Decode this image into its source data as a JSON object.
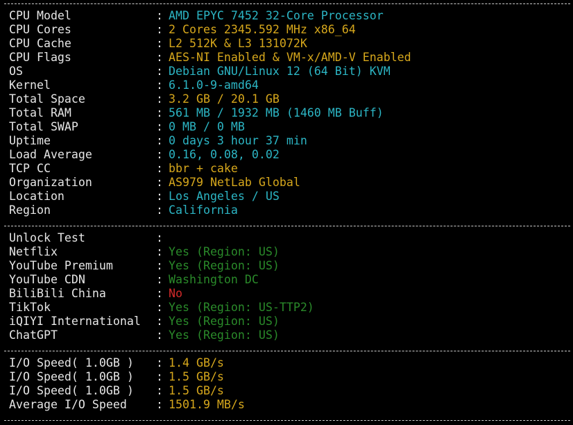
{
  "colors": {
    "cyan": "#2cb5c4",
    "yellow": "#d6a71c",
    "green": "#2a8a2a",
    "red": "#d22a2a"
  },
  "separator": "--------------------------------------------------------------------------------",
  "system": [
    {
      "label": "CPU Model",
      "value": "AMD EPYC 7452 32-Core Processor",
      "color": "cyan"
    },
    {
      "label": "CPU Cores",
      "value": "2 Cores 2345.592 MHz x86_64",
      "color": "yellow"
    },
    {
      "label": "CPU Cache",
      "value": "L2 512K & L3 131072K",
      "color": "yellow"
    },
    {
      "label": "CPU Flags",
      "value": "AES-NI Enabled & VM-x/AMD-V Enabled",
      "color": "yellow"
    },
    {
      "label": "OS",
      "value": "Debian GNU/Linux 12 (64 Bit) KVM",
      "color": "cyan"
    },
    {
      "label": "Kernel",
      "value": "6.1.0-9-amd64",
      "color": "cyan"
    },
    {
      "label": "Total Space",
      "value": "3.2 GB / 20.1 GB",
      "color": "yellow"
    },
    {
      "label": "Total RAM",
      "value": "561 MB / 1932 MB (1460 MB Buff)",
      "color": "cyan"
    },
    {
      "label": "Total SWAP",
      "value": "0 MB / 0 MB",
      "color": "cyan"
    },
    {
      "label": "Uptime",
      "value": "0 days 3 hour 37 min",
      "color": "cyan"
    },
    {
      "label": "Load Average",
      "value": "0.16, 0.08, 0.02",
      "color": "cyan"
    },
    {
      "label": "TCP CC",
      "value": "bbr + cake",
      "color": "yellow"
    },
    {
      "label": "Organization",
      "value": "AS979 NetLab Global",
      "color": "yellow"
    },
    {
      "label": "Location",
      "value": "Los Angeles / US",
      "color": "cyan"
    },
    {
      "label": "Region",
      "value": "California",
      "color": "cyan"
    }
  ],
  "unlock": [
    {
      "label": "Unlock Test",
      "value": "",
      "color": "cyan"
    },
    {
      "label": "Netflix",
      "value": "Yes (Region: US)",
      "color": "green"
    },
    {
      "label": "YouTube Premium",
      "value": "Yes (Region: US)",
      "color": "green"
    },
    {
      "label": "YouTube CDN",
      "value": "Washington DC",
      "color": "green"
    },
    {
      "label": "BiliBili China",
      "value": "No",
      "color": "red"
    },
    {
      "label": "TikTok",
      "value": "Yes (Region: US-TTP2)",
      "color": "green"
    },
    {
      "label": "iQIYI International",
      "value": "Yes (Region: US)",
      "color": "green"
    },
    {
      "label": "ChatGPT",
      "value": "Yes (Region: US)",
      "color": "green"
    }
  ],
  "io": [
    {
      "label": "I/O Speed( 1.0GB )",
      "value": "1.4 GB/s",
      "color": "yellow"
    },
    {
      "label": "I/O Speed( 1.0GB )",
      "value": "1.5 GB/s",
      "color": "yellow"
    },
    {
      "label": "I/O Speed( 1.0GB )",
      "value": "1.5 GB/s",
      "color": "yellow"
    },
    {
      "label": "Average I/O Speed",
      "value": "1501.9 MB/s",
      "color": "yellow"
    }
  ]
}
